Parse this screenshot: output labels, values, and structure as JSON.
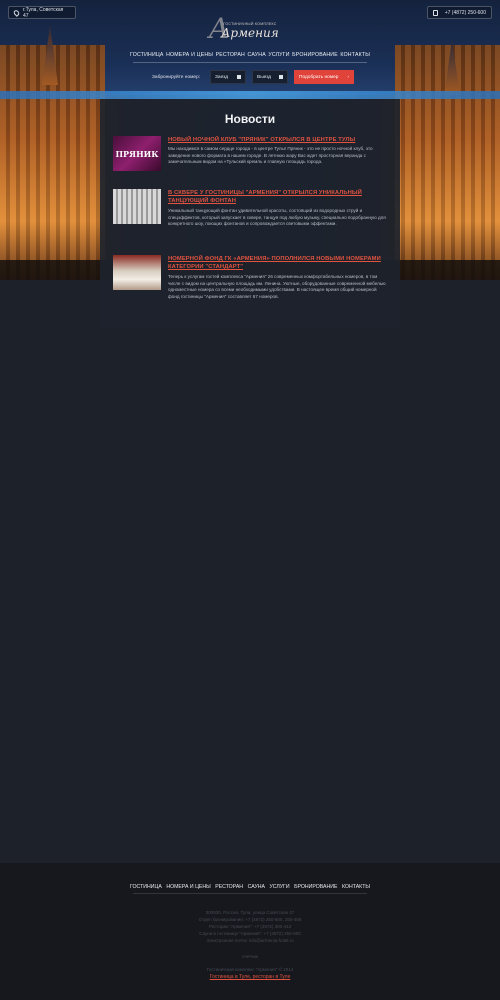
{
  "header": {
    "address": "г.Тула, Советская 47",
    "phone": "+7 (4872) 250-600",
    "logo_small": "ГОСТИНИЧНЫЙ КОМПЛЕКС",
    "logo_big": "Армения"
  },
  "nav": {
    "items": [
      "ГОСТИНИЦА",
      "НОМЕРА И ЦЕНЫ",
      "РЕСТОРАН",
      "САУНА",
      "УСЛУГИ",
      "БРОНИРОВАНИЕ",
      "КОНТАКТЫ"
    ]
  },
  "booking": {
    "label": "Забронируйте номер:",
    "checkin": "Заезд",
    "checkout": "Выезд",
    "button": "Подобрать номер",
    "button_arrow": "›"
  },
  "main": {
    "title": "Новости",
    "news": [
      {
        "headline": "НОВЫЙ НОЧНОЙ КЛУБ \"ПРЯНИК\" ОТКРЫЛСЯ В ЦЕНТРЕ ТУЛЫ",
        "text": "Мы находимся в самом сердце города - в центре Тулы! Пряник - это не просто ночной клуб, это заведение нового формата в нашем городе. В летнюю жару Вас ждет просторная веранда с замечательным видом на «Тульский кремль и главную площадь города.",
        "thumb_text": "ПРЯНИК"
      },
      {
        "headline": "В СКВЕРЕ У ГОСТИНИЦЫ \"АРМЕНИЯ\" ОТКРЫЛСЯ УНИКАЛЬНЫЙ ТАНЦУЮЩИЙ ФОНТАН",
        "text": "Уникальный танцующий фонтан удивительной красоты, состоящий из водородных струй и спецэффектов, который запускает в сквере, танцуя под любую музыку, специально подобранную для конкретного шоу, поющих фонтанов и сопровождается световыми эффектами."
      },
      {
        "headline": "НОМЕРНОЙ ФОНД ГК «АРМЕНИЯ» ПОПОЛНИЛСЯ НОВЫМИ НОМЕРАМИ КАТЕГОРИИ \"СТАНДАРТ\"",
        "text": "Теперь к услугам гостей комплекса \"Армения\" 26 современных комфортабельных номеров, в том числе с видом на центральную площадь им. Ленина. Уютные, оборудованные современной мебелью одноместные номера со всеми необходимыми удобствами. В настоящее время общий номерной фонд гостиницы \"Армения\" составляет 67 номеров."
      }
    ]
  },
  "footer": {
    "nav": [
      "ГОСТИНИЦА",
      "НОМЕРА И ЦЕНЫ",
      "РЕСТОРАН",
      "САУНА",
      "УСЛУГИ",
      "БРОНИРОВАНИЕ",
      "КОНТАКТЫ"
    ],
    "info": [
      "300000, Россия, Тула, улица Советская 47",
      "Отдел бронирования: +7 (4872) 250-600, 250-468",
      "Ресторан \"Армения\": +7 (4872) 300-413",
      "Сауна в гостинице \"Армения\": +7 (4872) 250-600",
      "Электронная почта: info@armenia-hotel.ru"
    ],
    "counter": "счетчик",
    "copyright": "Гостиничный комплекс \"Армения\" © 2014",
    "link": "Гостиница в Туле, ресторан в Туле"
  }
}
